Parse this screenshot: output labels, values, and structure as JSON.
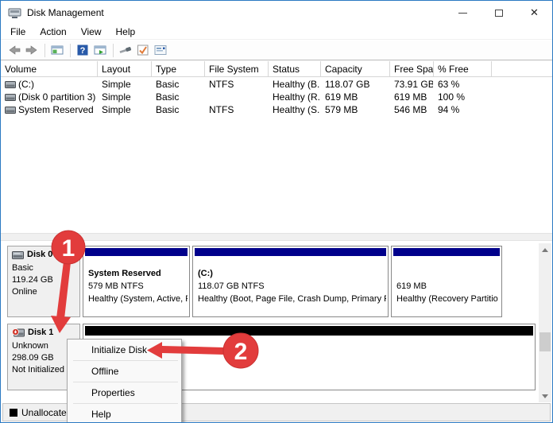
{
  "window": {
    "title": "Disk Management",
    "controls": {
      "close_glyph": "✕"
    }
  },
  "menu_bar": {
    "items": [
      {
        "label": "File"
      },
      {
        "label": "Action"
      },
      {
        "label": "View"
      },
      {
        "label": "Help"
      }
    ]
  },
  "toolbar": {
    "icons": [
      "back",
      "forward",
      "show-console-tree",
      "help",
      "show-action-pane",
      "launch-tool",
      "check-disk",
      "properties"
    ]
  },
  "volume_table": {
    "columns": [
      "Volume",
      "Layout",
      "Type",
      "File System",
      "Status",
      "Capacity",
      "Free Spa...",
      "% Free"
    ],
    "rows": [
      {
        "volume": "(C:)",
        "layout": "Simple",
        "type": "Basic",
        "fs": "NTFS",
        "status": "Healthy (B...",
        "capacity": "118.07 GB",
        "free": "73.91 GB",
        "pct": "63 %"
      },
      {
        "volume": "(Disk 0 partition 3)",
        "layout": "Simple",
        "type": "Basic",
        "fs": "",
        "status": "Healthy (R...",
        "capacity": "619 MB",
        "free": "619 MB",
        "pct": "100 %"
      },
      {
        "volume": "System Reserved",
        "layout": "Simple",
        "type": "Basic",
        "fs": "NTFS",
        "status": "Healthy (S...",
        "capacity": "579 MB",
        "free": "546 MB",
        "pct": "94 %"
      }
    ]
  },
  "disks": [
    {
      "name": "Disk 0",
      "type": "Basic",
      "size": "119.24 GB",
      "status": "Online",
      "partitions": [
        {
          "name": "System Reserved",
          "size_line": "579 MB NTFS",
          "status_line": "Healthy (System, Active, P"
        },
        {
          "name": "(C:)",
          "size_line": "118.07 GB NTFS",
          "status_line": "Healthy (Boot, Page File, Crash Dump, Primary Pa"
        },
        {
          "name": "",
          "size_line": "619 MB",
          "status_line": "Healthy (Recovery Partitio"
        }
      ]
    },
    {
      "name": "Disk 1",
      "type": "Unknown",
      "size": "298.09 GB",
      "status": "Not Initialized"
    }
  ],
  "context_menu": {
    "items": [
      "Initialize Disk",
      "Offline",
      "Properties",
      "Help"
    ]
  },
  "legend": {
    "unallocated_label": "Unallocated"
  },
  "annotations": {
    "step1": "1",
    "step2": "2",
    "accent_color": "#e23c3c"
  },
  "colors": {
    "partition_strip": "#00008b",
    "unallocated_strip": "#000000",
    "window_border": "#2b79c2"
  }
}
